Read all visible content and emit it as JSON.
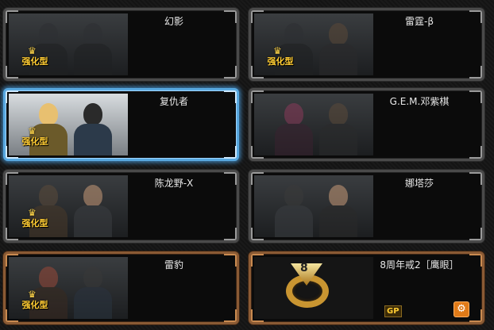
{
  "cards": [
    {
      "name": "幻影",
      "badge": "强化型",
      "crown": "♛"
    },
    {
      "name": "雷霆-β",
      "badge": "强化型",
      "crown": "♛"
    },
    {
      "name": "复仇者",
      "badge": "强化型",
      "crown": "♛"
    },
    {
      "name": "G.E.M.邓紫棋"
    },
    {
      "name": "陈龙野-X",
      "badge": "强化型",
      "crown": "♛"
    },
    {
      "name": "娜塔莎"
    },
    {
      "name": "雷豹",
      "badge": "强化型",
      "crown": "♛"
    },
    {
      "name": "8周年戒2［鹰眼］",
      "gp_label": "GP",
      "settings_icon": "gear-icon",
      "ring_mark": "8"
    }
  ],
  "colors": {
    "selected_border": "#58a8e0",
    "orange_border": "#8a5a34",
    "badge": "#ffcc33"
  }
}
